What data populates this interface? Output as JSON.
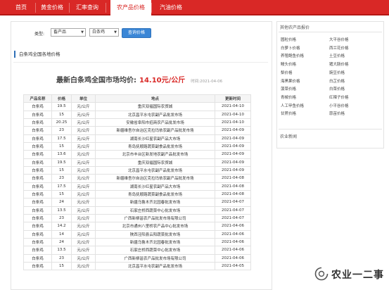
{
  "nav": {
    "items": [
      "首页",
      "黄金价格",
      "汇率查询",
      "农产品价格",
      "汽油价格"
    ],
    "active_index": 3,
    "bg_color": "#d92826"
  },
  "filter": {
    "type_label": "类型:",
    "category_value": "畜产品",
    "product_value": "白条鸡",
    "query_button": "查询价格"
  },
  "section": {
    "title": "白条鸡全国各地价格"
  },
  "headline": {
    "text": "最新白条鸡全国市场均价:",
    "price": "14.10元/公斤",
    "time": "时间:2021-04-06"
  },
  "table": {
    "headers": [
      "产品名称",
      "价格",
      "单位",
      "地点",
      "更新时间"
    ],
    "rows": [
      [
        "白条鸡",
        "19.5",
        "元/公斤",
        "重庆双福国际农贸城",
        "2021-04-10"
      ],
      [
        "白条鸡",
        "15",
        "元/公斤",
        "北京昌平水屯农副产品批发市场",
        "2021-04-10"
      ],
      [
        "白条鸡",
        "20.25",
        "元/公斤",
        "安徽省阜阳市招商农产品批发市场",
        "2021-04-10"
      ],
      [
        "白条鸡",
        "23",
        "元/公斤",
        "新疆维吾尔自治区克拉玛依农副产品批发市场",
        "2021-04-09"
      ],
      [
        "白条鸡",
        "17.5",
        "元/公斤",
        "湖南长沙红星农副产品大市场",
        "2021-04-09"
      ],
      [
        "白条鸡",
        "15",
        "元/公斤",
        "青岛抚顺路蔬菜副食品批发市场",
        "2021-04-09"
      ],
      [
        "白条鸡",
        "13.6",
        "元/公斤",
        "北京市丰台区新发地农副产品批发市场",
        "2021-04-09"
      ],
      [
        "白条鸡",
        "19.5",
        "元/公斤",
        "重庆双福国际农贸城",
        "2021-04-09"
      ],
      [
        "白条鸡",
        "15",
        "元/公斤",
        "北京昌平水屯农副产品批发市场",
        "2021-04-09"
      ],
      [
        "白条鸡",
        "23",
        "元/公斤",
        "新疆维吾尔自治区克拉玛依农副产品批发市场",
        "2021-04-08"
      ],
      [
        "白条鸡",
        "17.5",
        "元/公斤",
        "湖南长沙红星农副产品大市场",
        "2021-04-08"
      ],
      [
        "白条鸡",
        "15",
        "元/公斤",
        "青岛抚顺路蔬菜副食品批发市场",
        "2021-04-08"
      ],
      [
        "白条鸡",
        "24",
        "元/公斤",
        "新疆乌鲁木齐北园春批发市场",
        "2021-04-07"
      ],
      [
        "白条鸡",
        "13.5",
        "元/公斤",
        "石家庄桥西蔬菜中心批发市场",
        "2021-04-07"
      ],
      [
        "白条鸡",
        "23",
        "元/公斤",
        "广西新柳邕农产品批发市场有限公司",
        "2021-04-07"
      ],
      [
        "白条鸡",
        "14.2",
        "元/公斤",
        "北京市通州八里桥农产品中心批发市场",
        "2021-04-06"
      ],
      [
        "白条鸡",
        "14",
        "元/公斤",
        "陕西泾阳县云阳蔬菜批发市场",
        "2021-04-06"
      ],
      [
        "白条鸡",
        "24",
        "元/公斤",
        "新疆乌鲁木齐北园春批发市场",
        "2021-04-06"
      ],
      [
        "白条鸡",
        "13.5",
        "元/公斤",
        "石家庄桥西蔬菜中心批发市场",
        "2021-04-06"
      ],
      [
        "白条鸡",
        "23",
        "元/公斤",
        "广西新柳邕农产品批发市场有限公司",
        "2021-04-06"
      ],
      [
        "白条鸡",
        "15",
        "元/公斤",
        "北京昌平水屯农副产品批发市场",
        "2021-04-05"
      ]
    ]
  },
  "sidebar": {
    "title": "其他农产品报价",
    "links": [
      [
        "圆粒价格",
        "大平谷价格"
      ],
      [
        "白萝卜价格",
        "西兰花价格"
      ],
      [
        "养殖鲍鱼价格",
        "土豆价格"
      ],
      [
        "鳗头价格",
        "猪大肠价格"
      ],
      [
        "梨价格",
        "豌豆价格"
      ],
      [
        "海黑果价格",
        "白芷价格"
      ],
      [
        "菠菜价格",
        "白菜价格"
      ],
      [
        "青椒价格",
        "红辣子价格"
      ],
      [
        "人工甲鱼价格",
        "小平谷价格"
      ],
      [
        "甘蔗价格",
        "蒜苗价格"
      ]
    ],
    "news_title": "农业新闻"
  },
  "watermark": {
    "text": "农业一二事"
  }
}
